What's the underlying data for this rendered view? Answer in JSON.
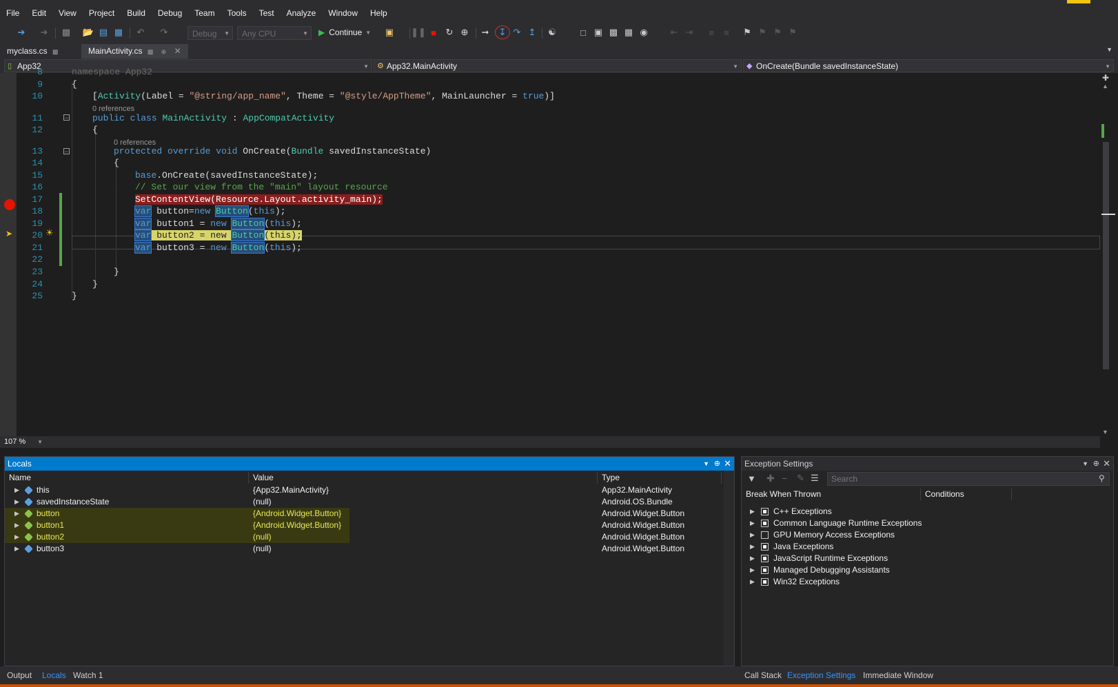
{
  "menu": [
    "File",
    "Edit",
    "View",
    "Project",
    "Build",
    "Debug",
    "Team",
    "Tools",
    "Test",
    "Analyze",
    "Window",
    "Help"
  ],
  "toolbar": {
    "config": "Debug",
    "platform": "Any CPU",
    "continue_label": "Continue",
    "icons": [
      "back-icon",
      "forward-icon",
      "new-project-icon",
      "open-icon",
      "save-icon",
      "save-all-icon",
      "undo-icon",
      "redo-icon",
      "continue-icon",
      "process-icon",
      "break-all-icon",
      "stop-icon",
      "restart-icon",
      "hot-reload-icon",
      "show-next-statement-icon",
      "step-into-icon",
      "step-over-icon",
      "step-out-icon",
      "hex-display-icon",
      "bookmark-icon"
    ]
  },
  "doc_tabs": [
    {
      "label": "myclass.cs",
      "pin": "⊡"
    },
    {
      "label": "MainActivity.cs",
      "pin": "⊡",
      "active": true
    }
  ],
  "nav": {
    "project": "App32",
    "type": "App32.MainActivity",
    "member": "OnCreate(Bundle savedInstanceState)"
  },
  "editor": {
    "zoom": "107 %",
    "line_numbers": [
      "8",
      "9",
      "10",
      "11",
      "12",
      "13",
      "14",
      "15",
      "16",
      "17",
      "18",
      "19",
      "20",
      "21",
      "22",
      "23",
      "24",
      "25"
    ],
    "references": "0 references",
    "breakpoint_line": "17",
    "current_line": "20",
    "line8": "namespace App32",
    "brace_open": "{",
    "brace_close": "}",
    "attr_prefix": "[",
    "attr_activity": "Activity",
    "attr_label": "(Label = ",
    "attr_label_val": "\"@string/app_name\"",
    "attr_theme": ", Theme = ",
    "attr_theme_val": "\"@style/AppTheme\"",
    "attr_main": ", MainLauncher = ",
    "attr_true": "true",
    "attr_suffix": ")]",
    "cls_public": "public",
    "cls_class": "class",
    "cls_name": "MainActivity",
    "cls_colon": " : ",
    "cls_base": "AppCompatActivity",
    "m_protected": "protected",
    "m_override": "override",
    "m_void": "void",
    "m_name": "OnCreate(",
    "m_bundle": "Bundle",
    "m_param": " savedInstanceState)",
    "l15_base": "base",
    "l15_rest": ".OnCreate(savedInstanceState);",
    "l16_comment": "// Set our view from the \"main\" layout resource",
    "l17": "SetContentView(Resource.Layout.activity_main);",
    "kw_var": "var",
    "kw_new": "new",
    "ty_button": "Button",
    "kw_this": "this",
    "l18_mid": " button=",
    "l19_mid": " button1 = ",
    "l20_mid": " button2 = ",
    "l21_mid": " button3 = ",
    "paren_open": "(",
    "paren_close": ");"
  },
  "locals": {
    "title": "Locals",
    "columns": [
      "Name",
      "Value",
      "Type"
    ],
    "rows": [
      {
        "name": "this",
        "value": "{App32.MainActivity}",
        "type": "App32.MainActivity",
        "changed": false
      },
      {
        "name": "savedInstanceState",
        "value": "(null)",
        "type": "Android.OS.Bundle",
        "changed": false
      },
      {
        "name": "button",
        "value": "{Android.Widget.Button}",
        "type": "Android.Widget.Button",
        "changed": true
      },
      {
        "name": "button1",
        "value": "{Android.Widget.Button}",
        "type": "Android.Widget.Button",
        "changed": true
      },
      {
        "name": "button2",
        "value": "(null)",
        "type": "Android.Widget.Button",
        "changed": true
      },
      {
        "name": "button3",
        "value": "(null)",
        "type": "Android.Widget.Button",
        "changed": false
      }
    ]
  },
  "exceptions": {
    "title": "Exception Settings",
    "search_placeholder": "Search",
    "columns": [
      "Break When Thrown",
      "Conditions"
    ],
    "items": [
      {
        "label": "C++ Exceptions",
        "checked": true
      },
      {
        "label": "Common Language Runtime Exceptions",
        "checked": true
      },
      {
        "label": "GPU Memory Access Exceptions",
        "checked": false
      },
      {
        "label": "Java Exceptions",
        "checked": true
      },
      {
        "label": "JavaScript Runtime Exceptions",
        "checked": true
      },
      {
        "label": "Managed Debugging Assistants",
        "checked": true
      },
      {
        "label": "Win32 Exceptions",
        "checked": true
      }
    ]
  },
  "bottom_tabs_left": [
    "Output",
    "Locals",
    "Watch 1"
  ],
  "bottom_tabs_right": [
    "Call Stack",
    "Exception Settings",
    "Immediate Window"
  ],
  "colors": {
    "accent": "#007acc",
    "breakpoint": "#e51400",
    "current_line": "#d7d56a",
    "changed_value": "#e8e85a"
  }
}
